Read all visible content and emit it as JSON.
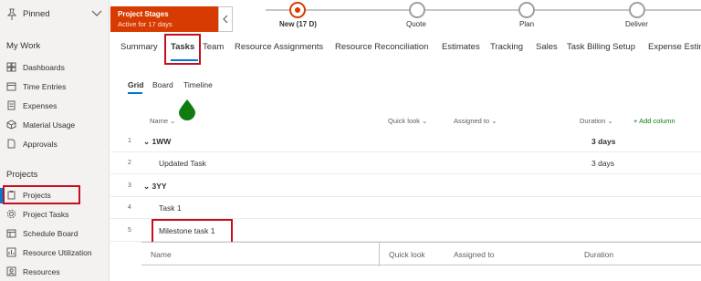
{
  "sidebar": {
    "pinned_label": "Pinned",
    "my_work_heading": "My Work",
    "my_work_items": [
      {
        "label": "Dashboards",
        "icon": "dashboard-icon"
      },
      {
        "label": "Time Entries",
        "icon": "calendar-icon"
      },
      {
        "label": "Expenses",
        "icon": "receipt-icon"
      },
      {
        "label": "Material Usage",
        "icon": "cube-icon"
      },
      {
        "label": "Approvals",
        "icon": "document-icon"
      }
    ],
    "projects_heading": "Projects",
    "project_items": [
      {
        "label": "Projects",
        "icon": "clipboard-icon",
        "active": true
      },
      {
        "label": "Project Tasks",
        "icon": "gear-icon"
      },
      {
        "label": "Schedule Board",
        "icon": "calendar-icon"
      },
      {
        "label": "Resource Utilization",
        "icon": "chart-icon"
      },
      {
        "label": "Resources",
        "icon": "person-icon"
      }
    ]
  },
  "stage": {
    "title": "Project Stages",
    "subtitle": "Active for 17 days",
    "stages": [
      {
        "label": "New  (17 D)",
        "active": true
      },
      {
        "label": "Quote",
        "active": false
      },
      {
        "label": "Plan",
        "active": false
      },
      {
        "label": "Deliver",
        "active": false
      }
    ]
  },
  "tabs": [
    "Summary",
    "Tasks",
    "Team",
    "Resource Assignments",
    "Resource Reconciliation",
    "Estimates",
    "Tracking",
    "Sales",
    "Task Billing Setup",
    "Expense Estim"
  ],
  "active_tab": "Tasks",
  "subtabs": [
    "Grid",
    "Board",
    "Timeline"
  ],
  "active_subtab": "Grid",
  "grid": {
    "headers": {
      "name": "Name",
      "quick_look": "Quick look",
      "assigned_to": "Assigned to",
      "duration": "Duration",
      "add_column": "Add column"
    },
    "rows": [
      {
        "num": "1",
        "name": "1WW",
        "duration": "3 days",
        "summary": true
      },
      {
        "num": "2",
        "name": "Updated Task",
        "duration": "3 days",
        "summary": false
      },
      {
        "num": "3",
        "name": "3YY",
        "duration": "",
        "summary": true
      },
      {
        "num": "4",
        "name": "Task 1",
        "duration": "",
        "summary": false
      },
      {
        "num": "5",
        "name": "Milestone task 1",
        "duration": "",
        "summary": false
      }
    ]
  },
  "footer": {
    "name": "Name",
    "quick_look": "Quick look",
    "assigned_to": "Assigned to",
    "duration": "Duration"
  },
  "colors": {
    "accent": "#0078d4",
    "stage": "#d83b01",
    "highlight": "#c50f1f",
    "drop": "#107c10"
  }
}
